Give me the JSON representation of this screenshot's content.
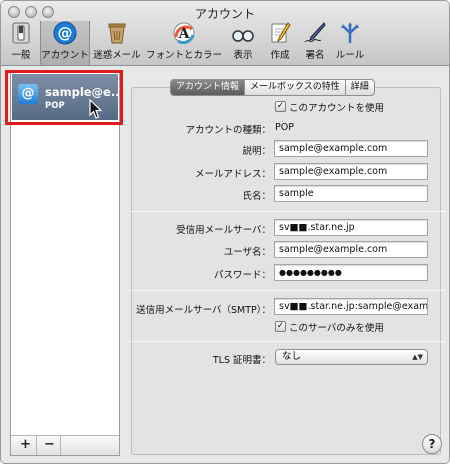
{
  "window": {
    "title": "アカウント"
  },
  "toolbar": {
    "items": [
      {
        "label": "一般",
        "icon": "switch-icon"
      },
      {
        "label": "アカウント",
        "icon": "at-sign-icon"
      },
      {
        "label": "迷惑メール",
        "icon": "trash-bin-icon"
      },
      {
        "label": "フォントとカラー",
        "icon": "font-icon"
      },
      {
        "label": "表示",
        "icon": "glasses-icon"
      },
      {
        "label": "作成",
        "icon": "pencil-paper-icon"
      },
      {
        "label": "署名",
        "icon": "pen-signature-icon"
      },
      {
        "label": "ルール",
        "icon": "rules-icon"
      }
    ],
    "selected_label": "アカウント"
  },
  "sidebar": {
    "account": {
      "name": "sample@e..",
      "type": "POP"
    },
    "add_label": "+",
    "remove_label": "−"
  },
  "tabs": [
    "アカウント情報",
    "メールボックスの特性",
    "詳細"
  ],
  "active_tab": "アカウント情報",
  "form": {
    "use_account_label": "このアカウントを使用",
    "use_account_checked": true,
    "account_type_label": "アカウントの種類：",
    "account_type_value": "POP",
    "description_label": "説明：",
    "description_value": "sample@example.com",
    "email_label": "メールアドレス：",
    "email_value": "sample@example.com",
    "fullname_label": "氏名：",
    "fullname_value": "sample",
    "incoming_server_label": "受信用メールサーバ：",
    "incoming_server_value": "sv■■.star.ne.jp",
    "username_label": "ユーザ名：",
    "username_value": "sample@example.com",
    "password_label": "パスワード：",
    "password_value": "●●●●●●●●●",
    "smtp_label": "送信用メールサーバ（SMTP）：",
    "smtp_value": "sv■■.star.ne.jp:sample@exampl",
    "only_this_server_label": "このサーバのみを使用",
    "only_this_server_checked": true,
    "tls_label": "TLS 証明書：",
    "tls_value": "なし"
  },
  "help_label": "?",
  "colors": {
    "highlight_border": "#e01b1b",
    "selection_bg": "#566a85"
  }
}
